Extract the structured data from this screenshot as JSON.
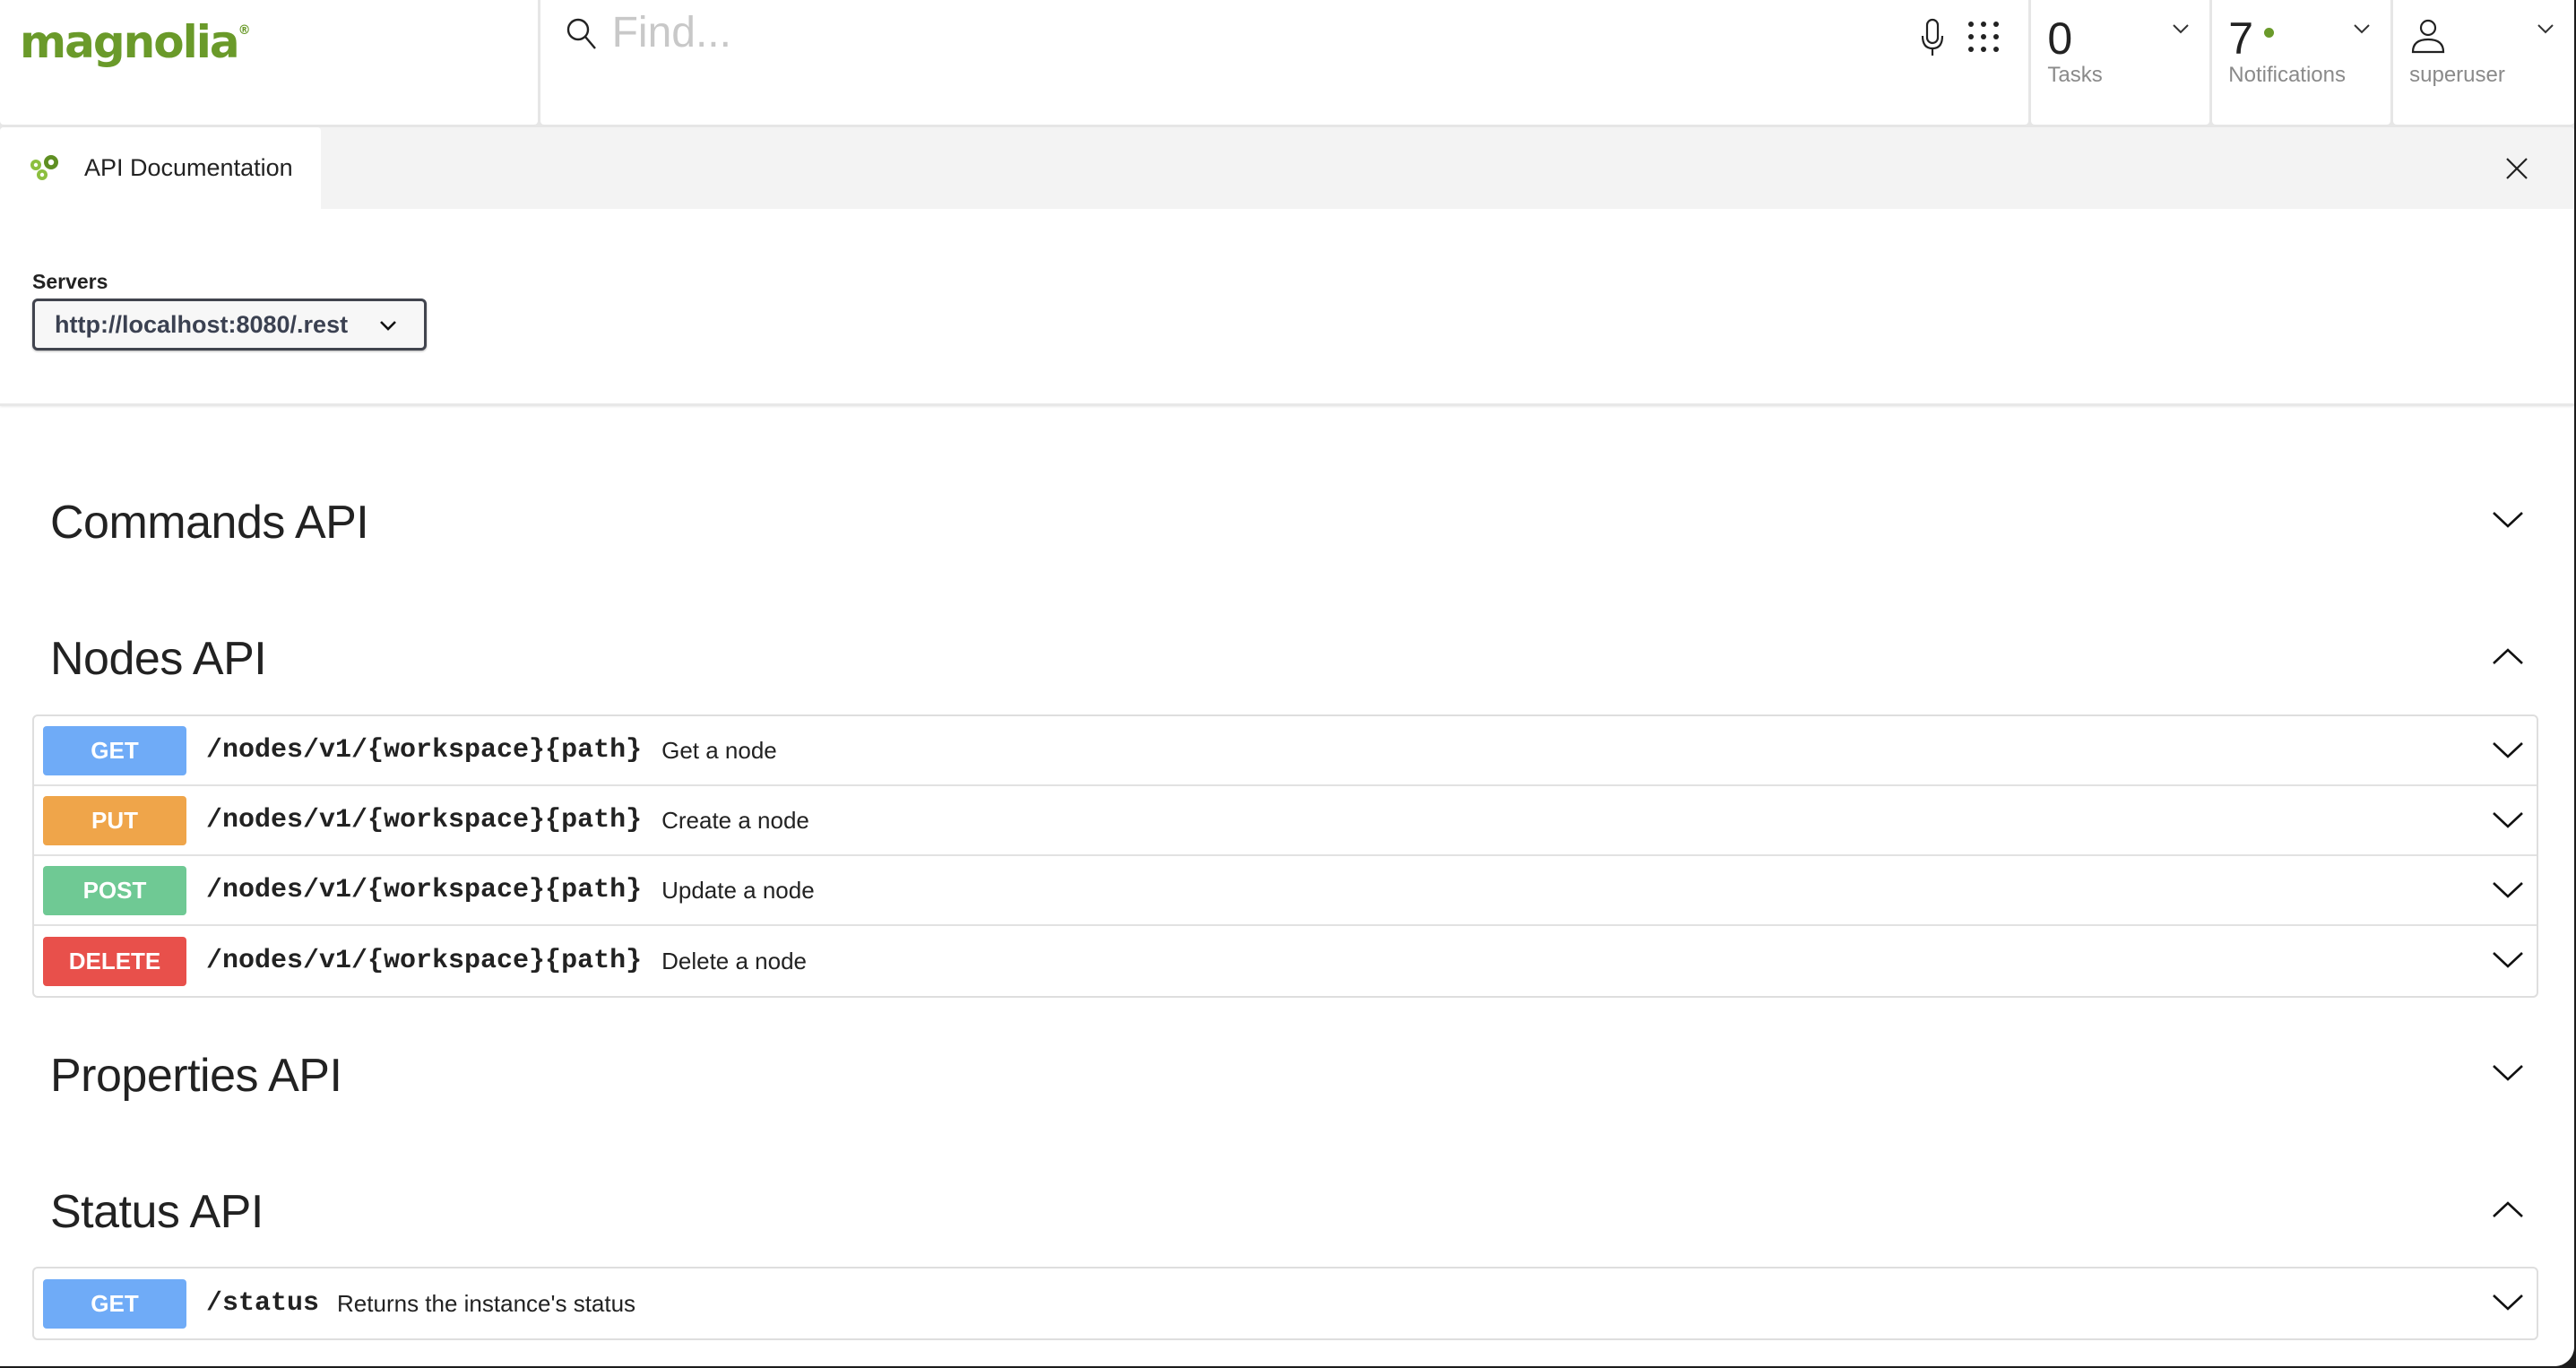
{
  "header": {
    "logo_text": "magnolia",
    "logo_mark": "®",
    "search": {
      "placeholder": "Find...",
      "value": "",
      "icon": "search-icon"
    },
    "mic_icon": "microphone-icon",
    "apps_icon": "app-launcher-grid-icon",
    "tasks": {
      "count": "0",
      "label": "Tasks"
    },
    "notifications": {
      "count": "7",
      "label": "Notifications",
      "has_unread_dot": true
    },
    "user": {
      "label": "superuser",
      "icon": "user-icon"
    }
  },
  "tabbar": {
    "active_tab": {
      "label": "API Documentation",
      "icon": "gears-icon"
    },
    "close_icon": "close-icon"
  },
  "servers": {
    "label": "Servers",
    "selected": "http://localhost:8080/.rest"
  },
  "sections": [
    {
      "title": "Commands API",
      "expanded": false,
      "operations": []
    },
    {
      "title": "Nodes API",
      "expanded": true,
      "operations": [
        {
          "method": "GET",
          "path": "/nodes/v1/{workspace}{path}",
          "summary": "Get a node"
        },
        {
          "method": "PUT",
          "path": "/nodes/v1/{workspace}{path}",
          "summary": "Create a node"
        },
        {
          "method": "POST",
          "path": "/nodes/v1/{workspace}{path}",
          "summary": "Update a node"
        },
        {
          "method": "DELETE",
          "path": "/nodes/v1/{workspace}{path}",
          "summary": "Delete a node"
        }
      ]
    },
    {
      "title": "Properties API",
      "expanded": false,
      "operations": []
    },
    {
      "title": "Status API",
      "expanded": true,
      "operations": [
        {
          "method": "GET",
          "path": "/status",
          "summary": "Returns the instance's status"
        }
      ]
    }
  ],
  "colors": {
    "brand": "#6a9a2a",
    "GET": "#6fabf7",
    "PUT": "#efa54a",
    "POST": "#6fc994",
    "DELETE": "#e8504b"
  }
}
